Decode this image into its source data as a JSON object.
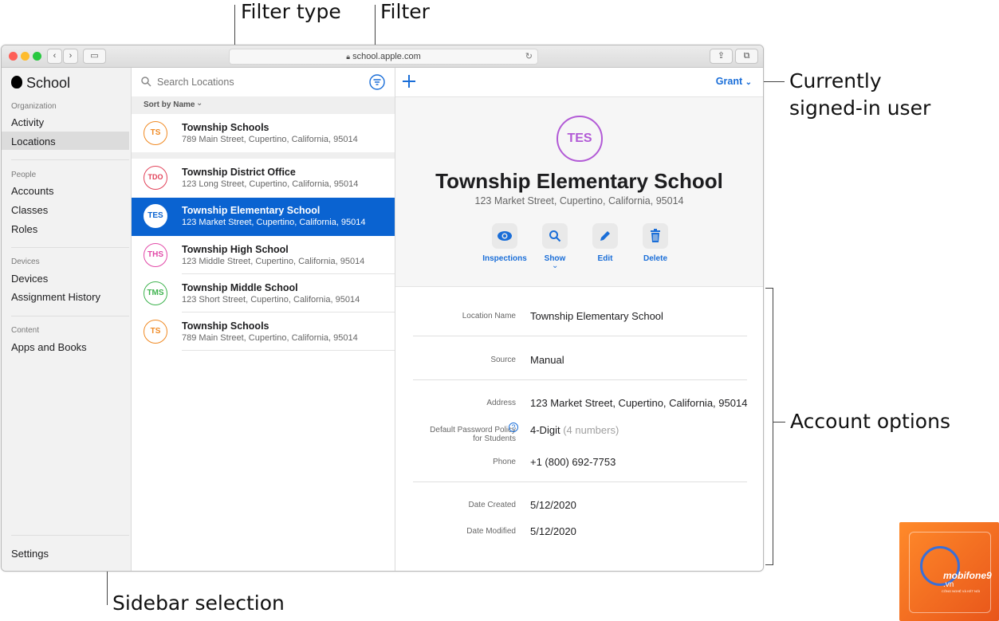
{
  "callouts": {
    "filter_type": "Filter type",
    "filter": "Filter",
    "signed_in_user": "Currently signed-in user",
    "signed_in_line1": "Currently",
    "signed_in_line2": "signed-in user",
    "account_options": "Account options",
    "sidebar_selection": "Sidebar selection"
  },
  "browser": {
    "url": "school.apple.com"
  },
  "sidebar": {
    "app_name": "School",
    "sections": [
      {
        "title": "Organization",
        "items": [
          "Activity",
          "Locations"
        ]
      },
      {
        "title": "People",
        "items": [
          "Accounts",
          "Classes",
          "Roles"
        ]
      },
      {
        "title": "Devices",
        "items": [
          "Devices",
          "Assignment History"
        ]
      },
      {
        "title": "Content",
        "items": [
          "Apps and Books"
        ]
      }
    ],
    "selected": "Locations",
    "settings": "Settings"
  },
  "list": {
    "search_placeholder": "Search Locations",
    "sort_label": "Sort by Name",
    "rows": [
      {
        "initials": "TS",
        "name": "Township Schools",
        "address": "789 Main Street, Cupertino, California, 95014",
        "color": "#f08a24"
      },
      {
        "initials": "TDO",
        "name": "Township District Office",
        "address": "123 Long Street, Cupertino, California, 95014",
        "color": "#e2435a"
      },
      {
        "initials": "TES",
        "name": "Township Elementary School",
        "address": "123 Market Street, Cupertino, California, 95014",
        "color": "#0a63d1"
      },
      {
        "initials": "THS",
        "name": "Township High School",
        "address": "123 Middle Street, Cupertino, California, 95014",
        "color": "#e24aa8"
      },
      {
        "initials": "TMS",
        "name": "Township Middle School",
        "address": "123 Short Street, Cupertino, California, 95014",
        "color": "#3fb34f"
      },
      {
        "initials": "TS",
        "name": "Township Schools",
        "address": "789 Main Street, Cupertino, California, 95014",
        "color": "#f08a24"
      }
    ]
  },
  "detail": {
    "user": "Grant",
    "initials": "TES",
    "title": "Township Elementary School",
    "subtitle": "123 Market Street, Cupertino, California, 95014",
    "actions": [
      "Inspections",
      "Show",
      "Edit",
      "Delete"
    ],
    "fields": {
      "location_name_label": "Location Name",
      "location_name": "Township Elementary School",
      "source_label": "Source",
      "source": "Manual",
      "address_label": "Address",
      "address": "123 Market Street, Cupertino, California, 95014",
      "policy_label_1": "Default Password Policy",
      "policy_label_2": "for Students",
      "policy": "4-Digit",
      "policy_hint": "(4 numbers)",
      "phone_label": "Phone",
      "phone": "+1 (800) 692-7753",
      "created_label": "Date Created",
      "created": "5/12/2020",
      "modified_label": "Date Modified",
      "modified": "5/12/2020"
    }
  },
  "watermark": {
    "brand": "mobifone9",
    "domain": ".vn",
    "tagline": "CÔNG NGHỆ VÀ KẾT NỐI"
  },
  "colors": {
    "accent": "#0a63d1",
    "selected_avatar": "#b25ad6"
  }
}
